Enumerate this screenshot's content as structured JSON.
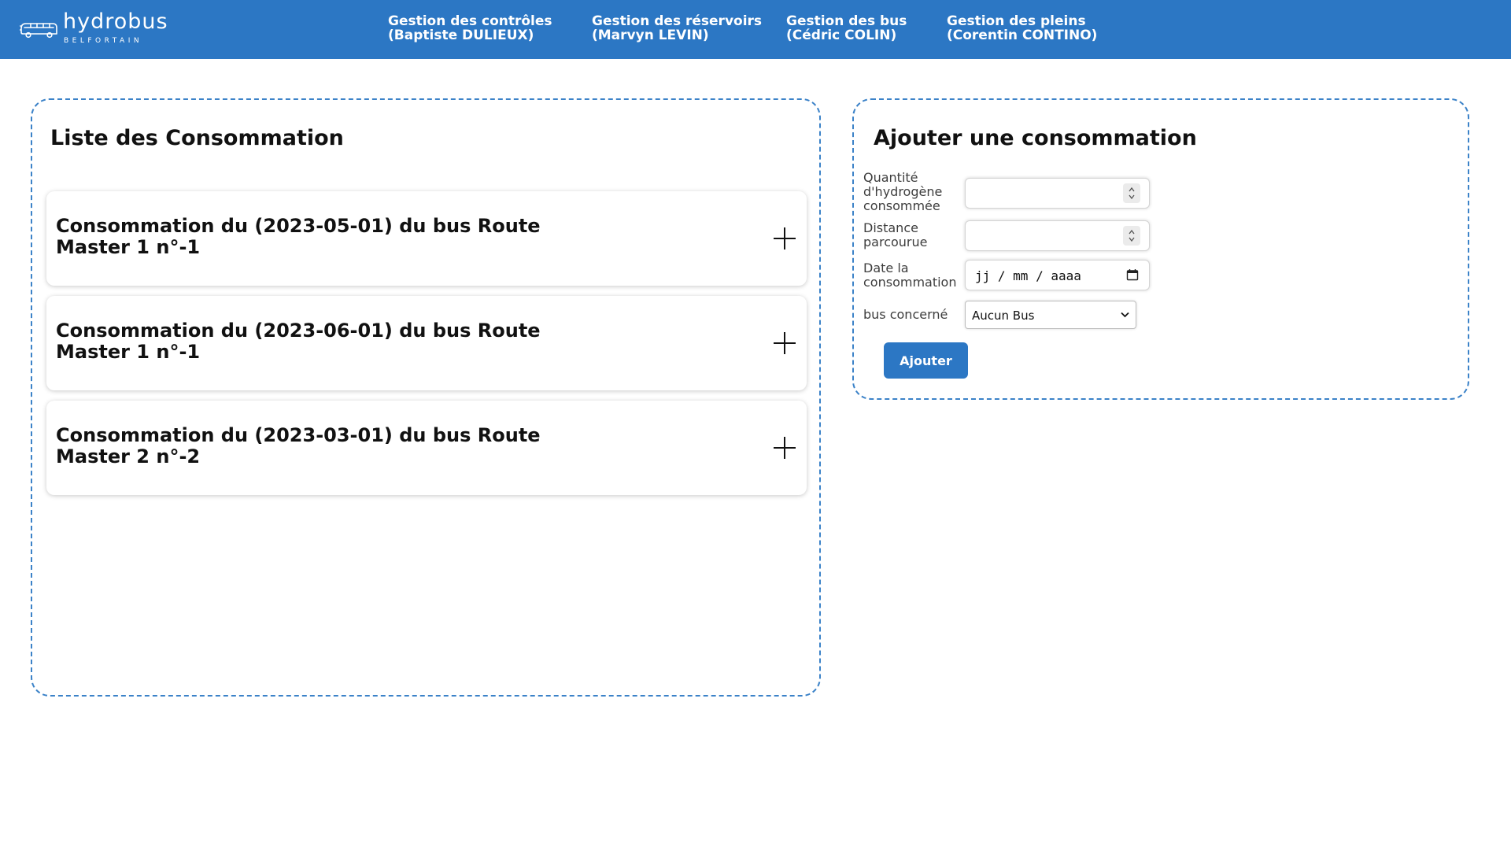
{
  "brand": {
    "name": "hydrobus",
    "tagline": "BELFORTAIN"
  },
  "nav": [
    {
      "line1": "Gestion des contrôles",
      "line2": "(Baptiste DULIEUX)"
    },
    {
      "line1": "Gestion des réservoirs",
      "line2": "(Marvyn LEVIN)"
    },
    {
      "line1": "Gestion des bus",
      "line2": "(Cédric COLIN)"
    },
    {
      "line1": "Gestion des pleins",
      "line2": "(Corentin CONTINO)"
    }
  ],
  "list_panel": {
    "title": "Liste des Consommation",
    "items": [
      {
        "title": "Consommation du (2023-05-01) du bus Route Master 1 n°-1"
      },
      {
        "title": "Consommation du (2023-06-01) du bus Route Master 1 n°-1"
      },
      {
        "title": "Consommation du (2023-03-01) du bus Route Master 2 n°-2"
      }
    ]
  },
  "form_panel": {
    "title": "Ajouter une consommation",
    "fields": {
      "hydrogen_label": "Quantité d'hydrogène consommée",
      "hydrogen_value": "",
      "distance_label": "Distance parcourue",
      "distance_value": "",
      "date_label": "Date la consommation",
      "date_placeholder": "jj / mm / aaaa",
      "bus_label": "bus concerné",
      "bus_selected": "Aucun Bus"
    },
    "submit_label": "Ajouter"
  },
  "colors": {
    "primary": "#2c77c4",
    "panel_border": "#3b82c8",
    "text": "#111111"
  },
  "icons": {
    "logo": "bus-icon",
    "expand": "plus-icon",
    "calendar": "calendar-icon",
    "select": "chevron-down-icon",
    "spinner": "spin-arrows-icon"
  }
}
